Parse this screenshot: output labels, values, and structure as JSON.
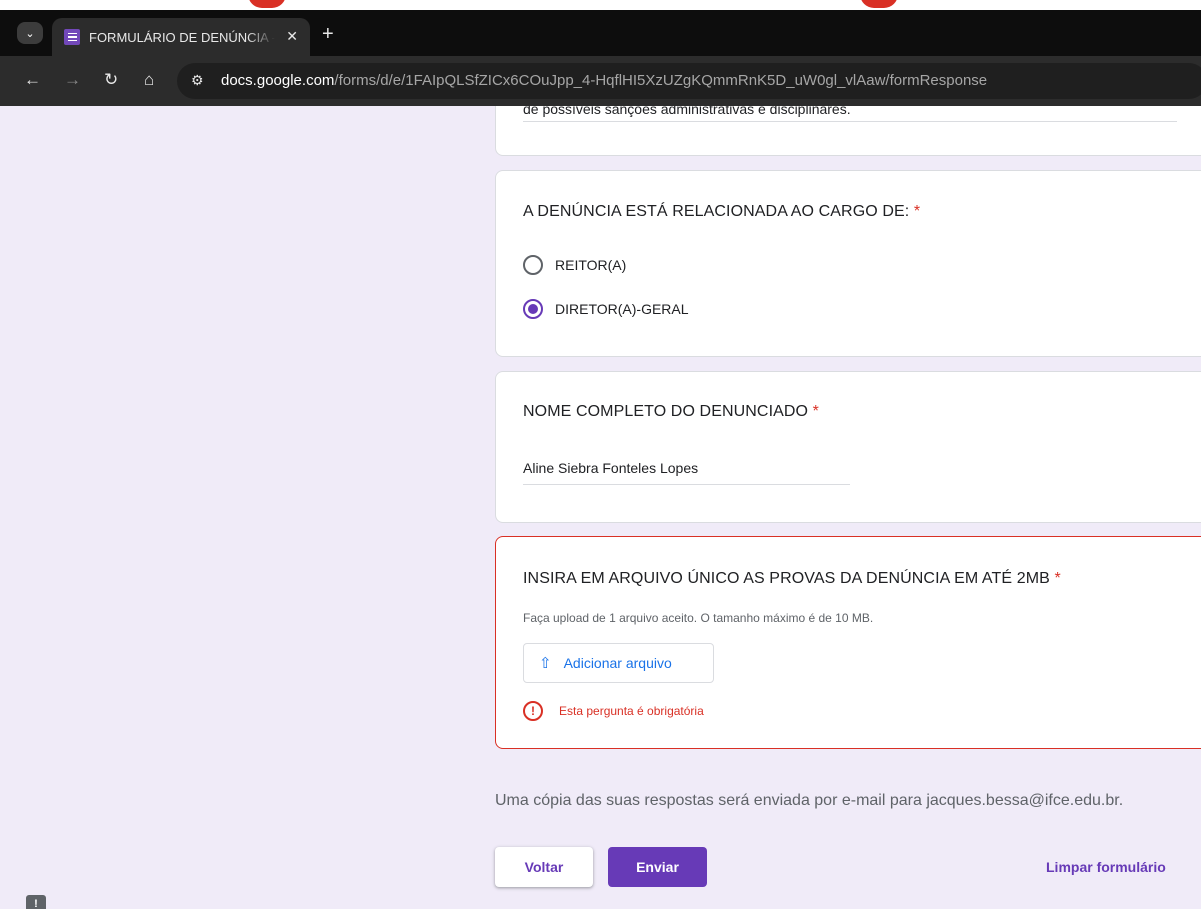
{
  "browser": {
    "tab_title": "FORMULÁRIO DE DENÚNCIA - IFCE",
    "close_glyph": "✕",
    "new_tab_glyph": "+",
    "url_host": "docs.google.com",
    "url_path": "/forms/d/e/1FAIpQLSfZICx6COuJpp_4-HqflHI5XzUZgKQmmRnK5D_uW0gl_vlAaw/formResponse"
  },
  "form": {
    "prev_card_text": "de possíveis sanções administrativas e disciplinares.",
    "cargo": {
      "question": "A DENÚNCIA ESTÁ RELACIONADA AO CARGO DE:",
      "required_mark": "*",
      "options": [
        {
          "label": "REITOR(A)",
          "selected": false
        },
        {
          "label": "DIRETOR(A)-GERAL",
          "selected": true
        }
      ]
    },
    "nome": {
      "question": "NOME COMPLETO DO DENUNCIADO",
      "required_mark": "*",
      "value": "Aline Siebra Fonteles Lopes"
    },
    "arquivo": {
      "question": "INSIRA EM ARQUIVO ÚNICO AS PROVAS DA DENÚNCIA EM ATÉ 2MB",
      "required_mark": "*",
      "hint": "Faça upload de 1 arquivo aceito. O tamanho máximo é de 10 MB.",
      "button_label": "Adicionar arquivo",
      "error": "Esta pergunta é obrigatória"
    },
    "copy_note": "Uma cópia das suas respostas será enviada por e-mail para jacques.bessa@ifce.edu.br.",
    "back_label": "Voltar",
    "submit_label": "Enviar",
    "clear_label": "Limpar formulário",
    "report_glyph": "!"
  },
  "colors": {
    "accent": "#673ab7",
    "error": "#d93025",
    "page_bg": "#f0ebf8",
    "link_blue": "#1a73e8"
  }
}
